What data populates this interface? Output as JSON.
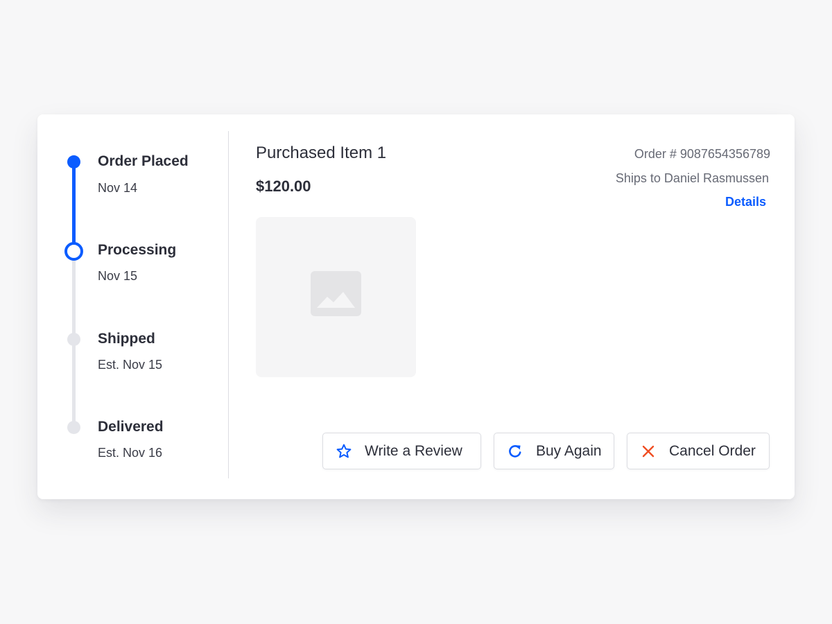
{
  "timeline": {
    "steps": [
      {
        "label": "Order Placed",
        "date": "Nov 14",
        "status": "complete"
      },
      {
        "label": "Processing",
        "date": "Nov 15",
        "status": "current"
      },
      {
        "label": "Shipped",
        "date": "Est. Nov 15",
        "status": "pending"
      },
      {
        "label": "Delivered",
        "date": "Est. Nov 16",
        "status": "pending"
      }
    ]
  },
  "item": {
    "title": "Purchased Item 1",
    "price": "$120.00",
    "image_icon": "image-placeholder-icon"
  },
  "order": {
    "number": "Order # 9087654356789",
    "ships_to": "Ships to Daniel Rasmussen",
    "details_label": "Details"
  },
  "actions": {
    "review": {
      "label": "Write a Review",
      "icon": "star-icon"
    },
    "buy_again": {
      "label": "Buy Again",
      "icon": "refresh-icon"
    },
    "cancel": {
      "label": "Cancel Order",
      "icon": "close-icon"
    }
  },
  "colors": {
    "accent": "#0b5cff",
    "danger": "#f04e23",
    "pending": "#e4e5ea",
    "background": "#f7f7f8"
  }
}
